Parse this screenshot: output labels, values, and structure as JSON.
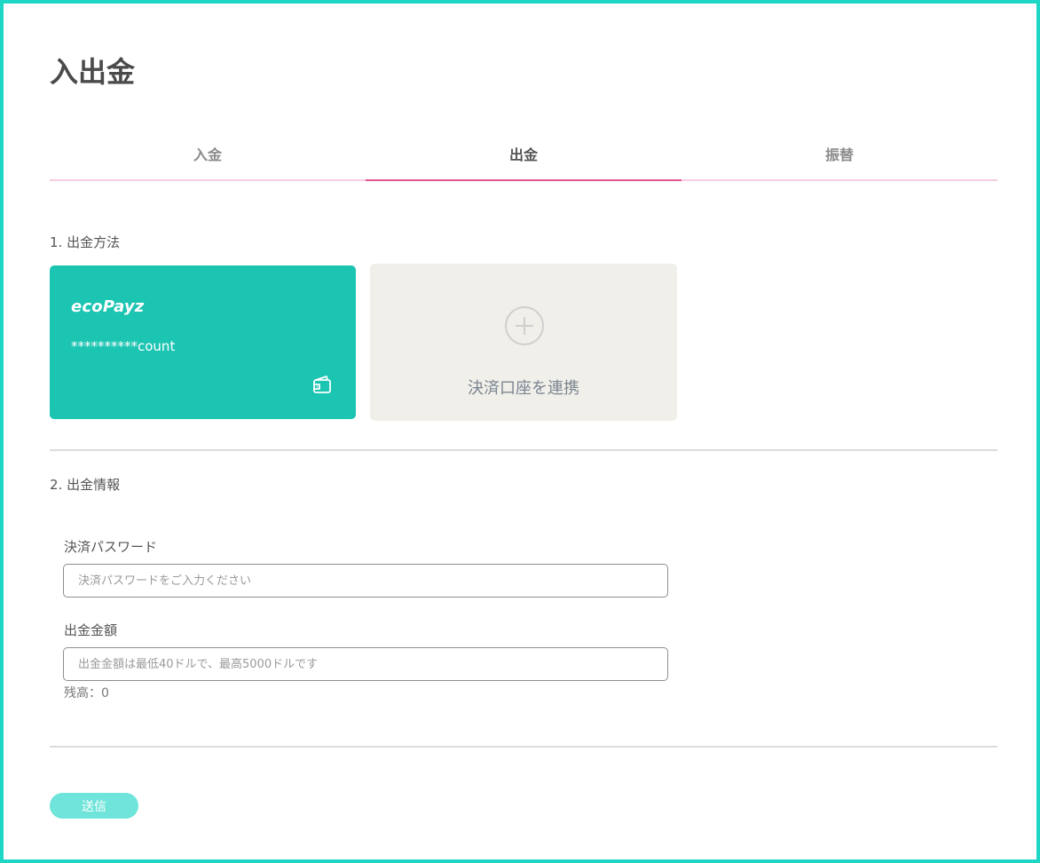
{
  "page": {
    "title": "入出金"
  },
  "tabs": [
    {
      "label": "入金",
      "active": false
    },
    {
      "label": "出金",
      "active": true
    },
    {
      "label": "振替",
      "active": false
    }
  ],
  "section1": {
    "title": "1. 出金方法"
  },
  "methods": {
    "ecopayz": {
      "logo": "ecoPayz",
      "account": "**********count",
      "icon": "wallet-icon"
    },
    "add": {
      "label": "決済口座を連携",
      "icon": "plus-circle-icon"
    }
  },
  "section2": {
    "title": "2. 出金情報"
  },
  "form": {
    "password": {
      "label": "決済パスワード",
      "placeholder": "決済パスワードをご入力ください",
      "value": ""
    },
    "amount": {
      "label": "出金金額",
      "placeholder": "出金金額は最低40ドルで、最高5000ドルです",
      "value": ""
    },
    "balance": "残高：0"
  },
  "submit": {
    "label": "送信"
  },
  "colors": {
    "frame": "#1ed6c6",
    "card": "#1cc4b2",
    "tab_active_underline": "#e2558f",
    "tab_underline": "#f6cde1",
    "submit": "#6ee4da",
    "add_card_bg": "#f1efe9"
  }
}
